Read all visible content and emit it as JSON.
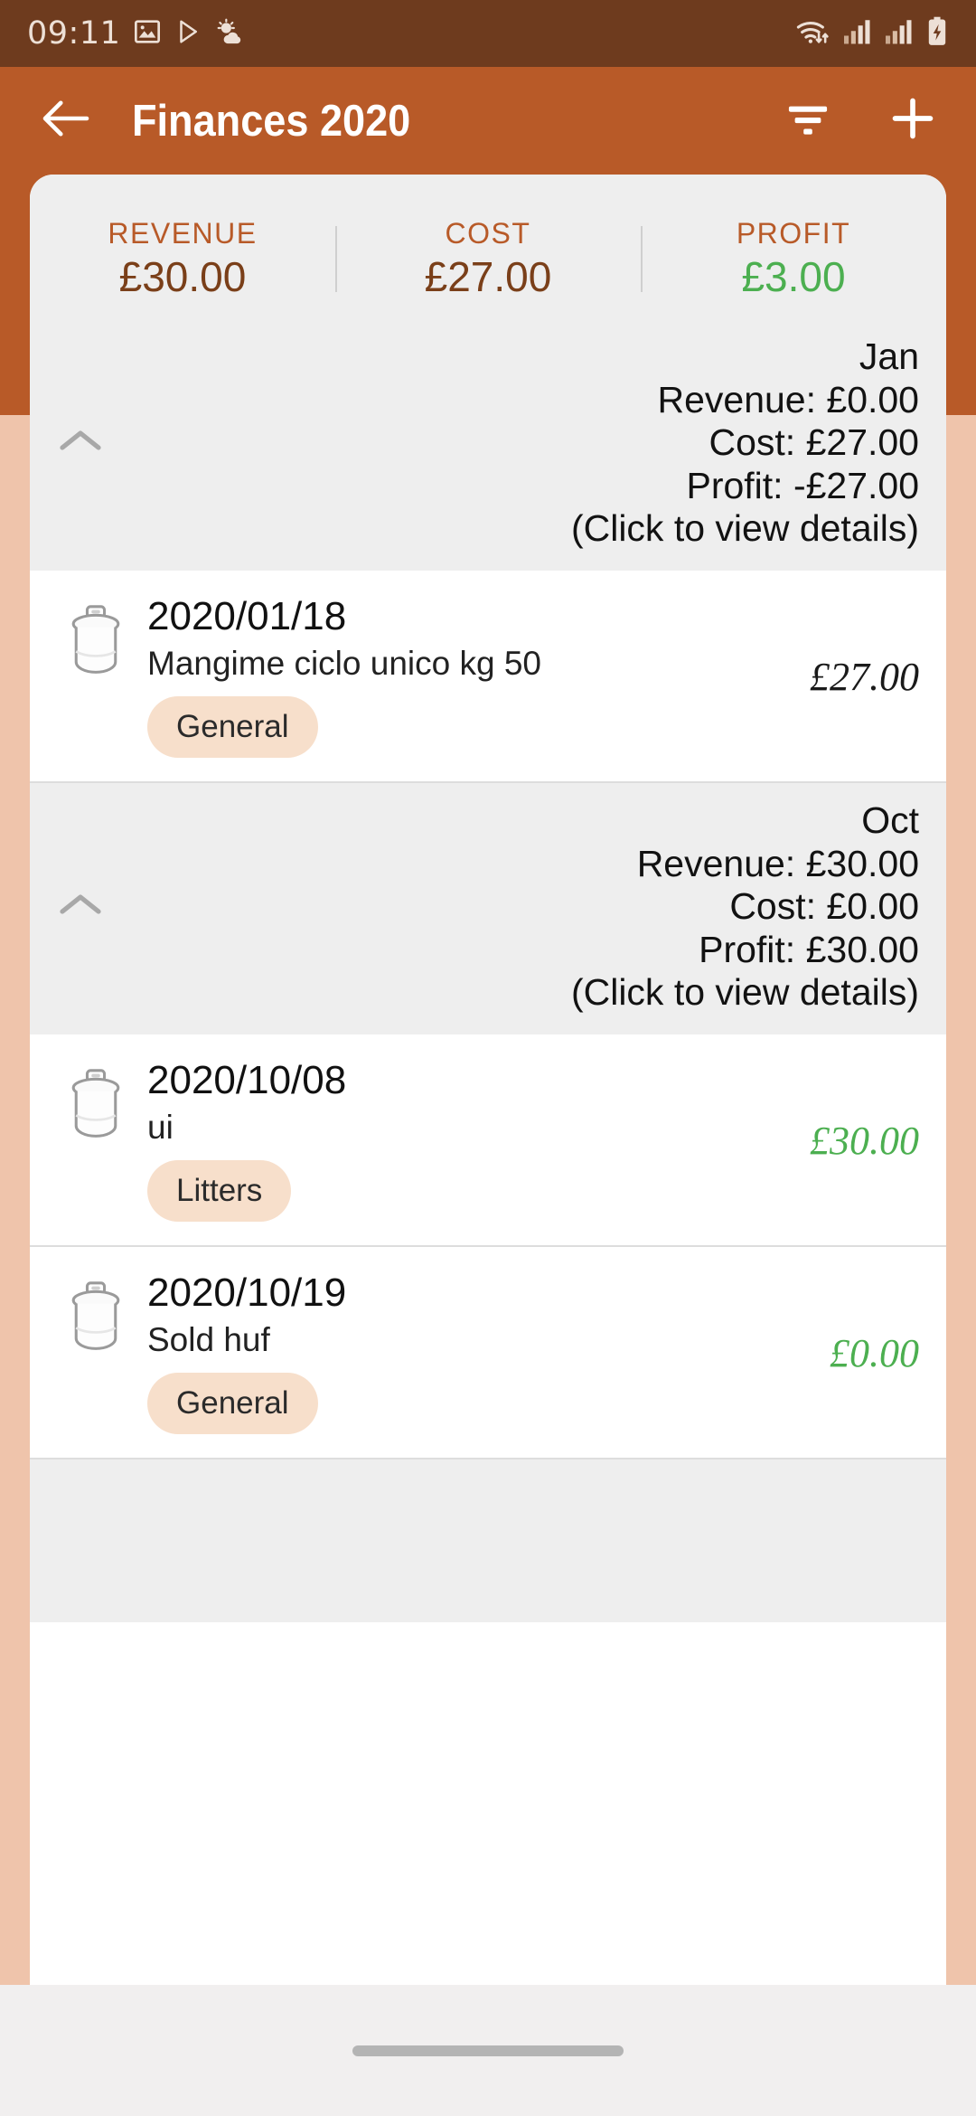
{
  "statusbar": {
    "time": "09:11",
    "left_icons": [
      "image-icon",
      "play-icon",
      "weather-icon"
    ],
    "right_icons": [
      "wifi-icon",
      "signal-icon-1",
      "signal-icon-2",
      "battery-charging-icon"
    ]
  },
  "appbar": {
    "back_icon": "back-arrow-icon",
    "title": "Finances 2020",
    "filter_icon": "filter-icon",
    "add_icon": "plus-icon"
  },
  "summary": {
    "columns": [
      {
        "label": "REVENUE",
        "value": "£30.00",
        "tone": "brown"
      },
      {
        "label": "COST",
        "value": "£27.00",
        "tone": "brown"
      },
      {
        "label": "PROFIT",
        "value": "£3.00",
        "tone": "green"
      }
    ]
  },
  "hint": "(Click to view details)",
  "months": [
    {
      "name": "Jan",
      "revenue": "Revenue: £0.00",
      "cost": "Cost: £27.00",
      "profit": "Profit: -£27.00",
      "hint": "(Click to view details)",
      "collapse_icon": "chevron-up-icon",
      "transactions": [
        {
          "icon": "trash-bin-icon",
          "date": "2020/01/18",
          "description": "Mangime ciclo unico kg 50",
          "tag": "General",
          "amount": "£27.00",
          "tone": "dark"
        }
      ]
    },
    {
      "name": "Oct",
      "revenue": "Revenue: £30.00",
      "cost": "Cost: £0.00",
      "profit": "Profit: £30.00",
      "hint": "(Click to view details)",
      "collapse_icon": "chevron-up-icon",
      "transactions": [
        {
          "icon": "trash-bin-icon",
          "date": "2020/10/08",
          "description": "ui",
          "tag": "Litters",
          "amount": "£30.00",
          "tone": "green"
        },
        {
          "icon": "trash-bin-icon",
          "date": "2020/10/19",
          "description": "Sold huf",
          "tag": "General",
          "amount": "£0.00",
          "tone": "green"
        }
      ]
    }
  ],
  "colors": {
    "status_bar": "#6E3B1E",
    "app_bar": "#B85A28",
    "accent": "#B85A28",
    "amount_brown": "#7A3F19",
    "positive_green": "#4CAF50",
    "page_bg": "#EFC4AB",
    "card_bg": "#FFFFFF",
    "section_bg": "#EEEEEE",
    "chip_bg": "#F7DFCB"
  },
  "gesture_bar": "home-indicator"
}
